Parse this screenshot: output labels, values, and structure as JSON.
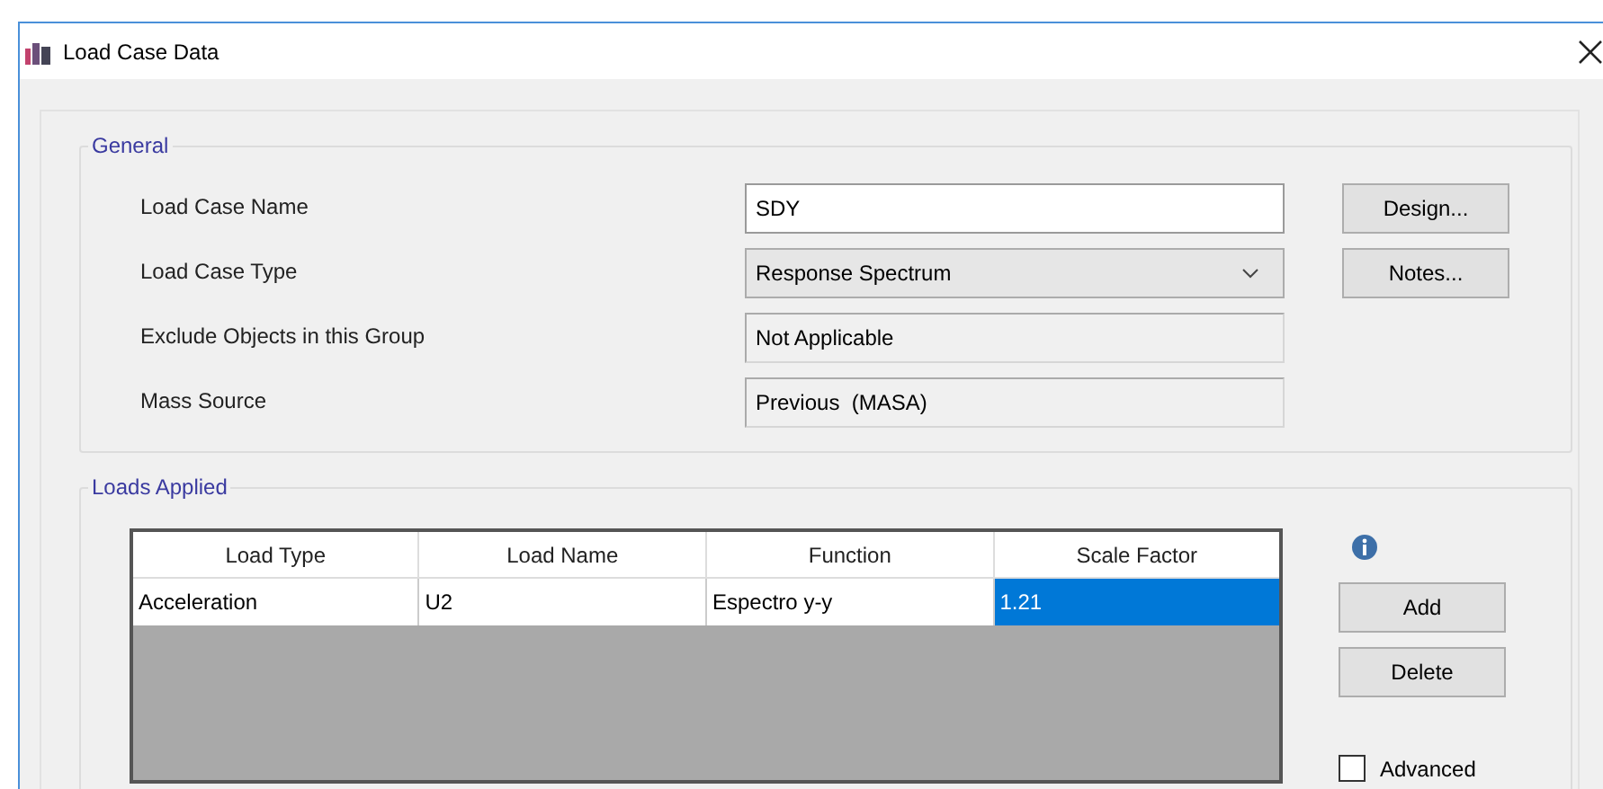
{
  "window": {
    "title": "Load Case Data"
  },
  "general": {
    "title": "General",
    "fields": [
      {
        "label": "Load Case Name",
        "kind": "text",
        "value": "SDY"
      },
      {
        "label": "Load Case Type",
        "kind": "dropdown",
        "value": "Response Spectrum"
      },
      {
        "label": "Exclude Objects in this Group",
        "kind": "readonly",
        "value": "Not Applicable"
      },
      {
        "label": "Mass Source",
        "kind": "readonly",
        "value": "Previous  (MASA)"
      }
    ],
    "buttons": [
      "Design...",
      "Notes..."
    ]
  },
  "loads": {
    "title": "Loads Applied",
    "table": {
      "columns": [
        "Load Type",
        "Load Name",
        "Function",
        "Scale Factor"
      ],
      "rows": [
        {
          "cells": [
            {
              "text": "Acceleration",
              "selected": false
            },
            {
              "text": "U2",
              "selected": false
            },
            {
              "text": "Espectro y-y",
              "selected": false
            },
            {
              "text": "1.21",
              "selected": true
            }
          ]
        }
      ]
    },
    "buttons": [
      "Add",
      "Delete"
    ],
    "advanced": {
      "label": "Advanced",
      "checked": false
    }
  }
}
